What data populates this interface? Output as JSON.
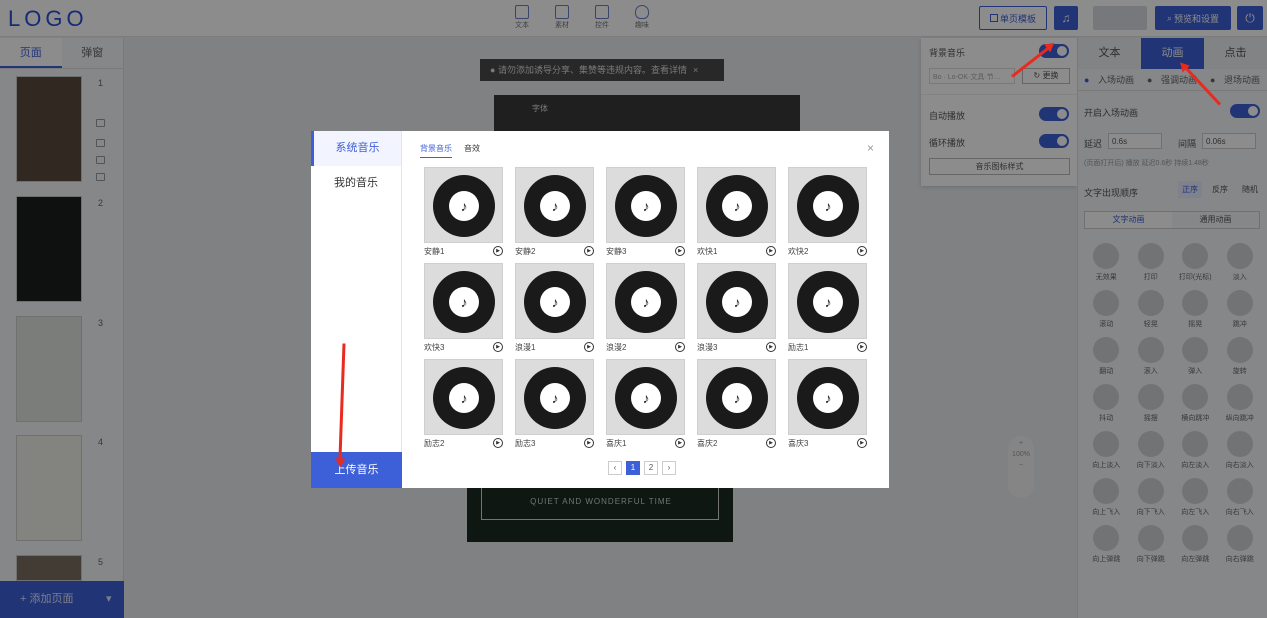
{
  "header": {
    "logo": "LOGO",
    "tools": [
      {
        "label": "文本",
        "icon": "text-icon"
      },
      {
        "label": "素材",
        "icon": "image-icon"
      },
      {
        "label": "控件",
        "icon": "widgets-icon"
      },
      {
        "label": "趣味",
        "icon": "bulb-icon"
      }
    ],
    "single_page_template": "单页模板",
    "music_icon": "music-note-icon",
    "preview_settings": "预览和设置",
    "power_icon": "power-icon"
  },
  "left_panel": {
    "tabs": [
      "页面",
      "弹窗"
    ],
    "pages": [
      "1",
      "2",
      "3",
      "4",
      "5"
    ],
    "add_page": "+ 添加页面"
  },
  "canvas": {
    "notice": "请勿添加诱导分享、集赞等违规内容。查看详情",
    "font_label": "字体",
    "zoom": "100%",
    "slogan": "QUIET AND WONDERFUL TIME"
  },
  "music_panel": {
    "bg_music_label": "背景音乐",
    "current_track": "Bo · Lo-OK·文具·节…",
    "change": "更换",
    "autoplay_label": "自动播放",
    "loop_label": "循环播放",
    "icon_style": "音乐图标样式"
  },
  "right_panel": {
    "tabs": [
      "文本",
      "动画",
      "点击"
    ],
    "sub_tabs": [
      "入场动画",
      "强调动画",
      "退场动画"
    ],
    "enable_label": "开启入场动画",
    "delay_label": "延迟",
    "delay_value": "0.6s",
    "interval_label": "间隔",
    "interval_value": "0.06s",
    "note": "(页面打开后) 播放 延迟0.6秒 持续1.48秒",
    "order_label": "文字出现顺序",
    "order_options": [
      "正序",
      "反序",
      "随机"
    ],
    "anim_types": [
      "文字动画",
      "通用动画"
    ],
    "animations": [
      "无效果",
      "打印",
      "打印(光标)",
      "淡入",
      "滚动",
      "轻晃",
      "摇晃",
      "跳冲",
      "翻动",
      "滚入",
      "弹入",
      "旋转",
      "抖动",
      "摇摆",
      "横向跳冲",
      "纵向跳冲",
      "向上淡入",
      "向下淡入",
      "向左淡入",
      "向右淡入",
      "向上飞入",
      "向下飞入",
      "向左飞入",
      "向右飞入",
      "向上弹跳",
      "向下弹跳",
      "向左弹跳",
      "向右弹跳"
    ]
  },
  "modal": {
    "sidebar": [
      "系统音乐",
      "我的音乐"
    ],
    "upload": "上传音乐",
    "tabs": [
      "背景音乐",
      "音效"
    ],
    "tracks": [
      "安静1",
      "安静2",
      "安静3",
      "欢快1",
      "欢快2",
      "欢快3",
      "浪漫1",
      "浪漫2",
      "浪漫3",
      "励志1",
      "励志2",
      "励志3",
      "喜庆1",
      "喜庆2",
      "喜庆3"
    ],
    "pages": [
      "1",
      "2"
    ],
    "current_page": "1"
  },
  "colors": {
    "accent": "#3d5fd8",
    "annotation_arrow": "#e82a1f"
  }
}
